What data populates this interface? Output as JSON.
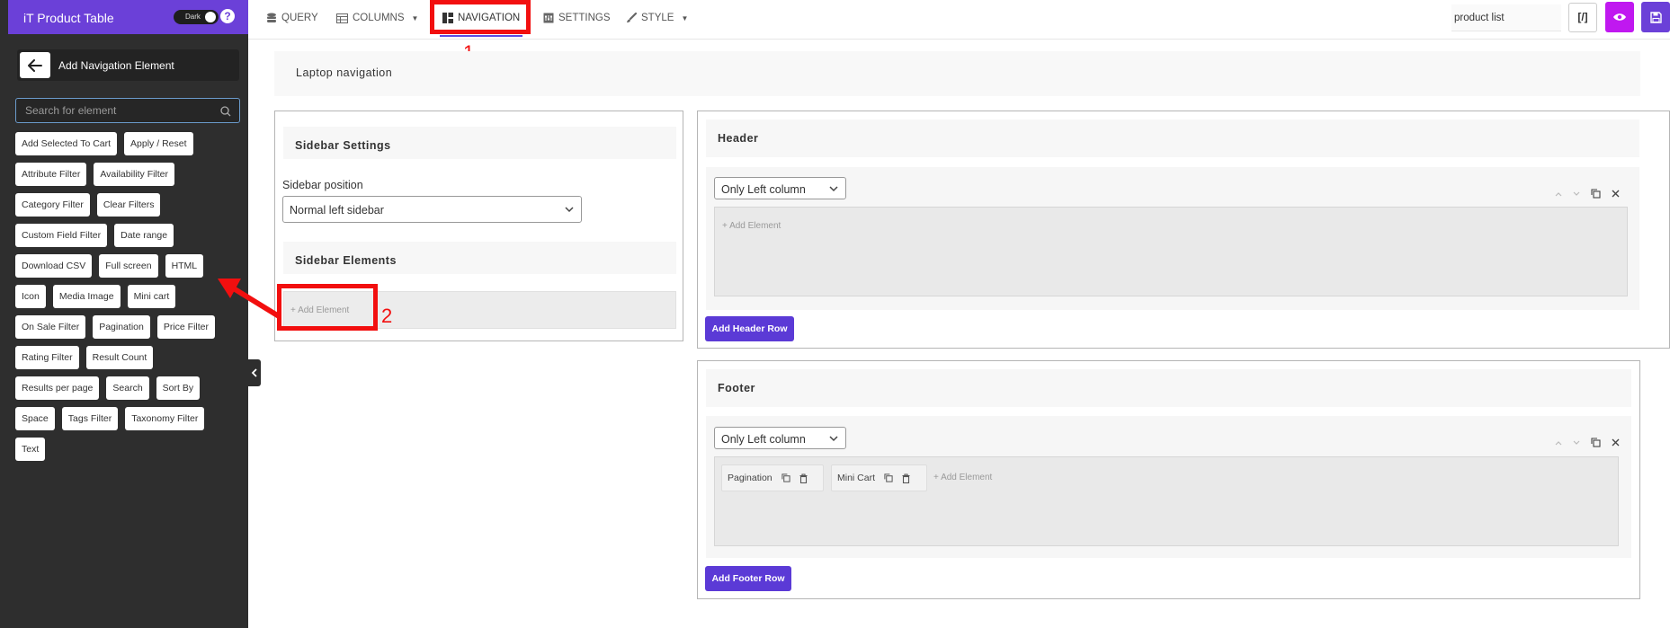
{
  "app": {
    "title": "iT Product Table",
    "dark_toggle_label": "Dark",
    "help_symbol": "?"
  },
  "left_panel": {
    "title": "Add Navigation Element",
    "search_placeholder": "Search for element",
    "elements": [
      [
        "Add Selected To Cart",
        "Apply / Reset"
      ],
      [
        "Attribute Filter",
        "Availability Filter"
      ],
      [
        "Category Filter",
        "Clear Filters"
      ],
      [
        "Custom Field Filter",
        "Date range"
      ],
      [
        "Download CSV",
        "Full screen",
        "HTML"
      ],
      [
        "Icon",
        "Media Image",
        "Mini cart"
      ],
      [
        "On Sale Filter",
        "Pagination",
        "Price Filter"
      ],
      [
        "Rating Filter",
        "Result Count"
      ],
      [
        "Results per page",
        "Search",
        "Sort By"
      ],
      [
        "Space",
        "Tags Filter",
        "Taxonomy Filter"
      ],
      [
        "Text"
      ]
    ]
  },
  "topbar": {
    "tabs": {
      "query": "QUERY",
      "columns": "COLUMNS",
      "navigation": "NAVIGATION",
      "settings": "SETTINGS",
      "style": "STYLE"
    },
    "active_tab": "navigation",
    "table_name_value": "product list",
    "code_button_label": "[/]"
  },
  "annotations": {
    "step1": "1",
    "step2": "2",
    "color": "#f20f0f"
  },
  "main": {
    "device_title": "Laptop navigation",
    "sidebar": {
      "settings_title": "Sidebar Settings",
      "position_label": "Sidebar position",
      "position_value": "Normal left sidebar",
      "elements_title": "Sidebar Elements",
      "add_element": "+ Add Element"
    },
    "header": {
      "title": "Header",
      "columns_value": "Only Left column",
      "add_element": "+ Add Element",
      "add_row_label": "Add Header Row"
    },
    "footer": {
      "title": "Footer",
      "columns_value": "Only Left column",
      "items": [
        "Pagination",
        "Mini Cart"
      ],
      "add_element": "+ Add Element",
      "add_row_label": "Add Footer Row"
    }
  },
  "colors": {
    "brand_purple": "#6b40d8",
    "preview_magenta": "#c018f0",
    "panel_dark": "#2e2e2e"
  }
}
